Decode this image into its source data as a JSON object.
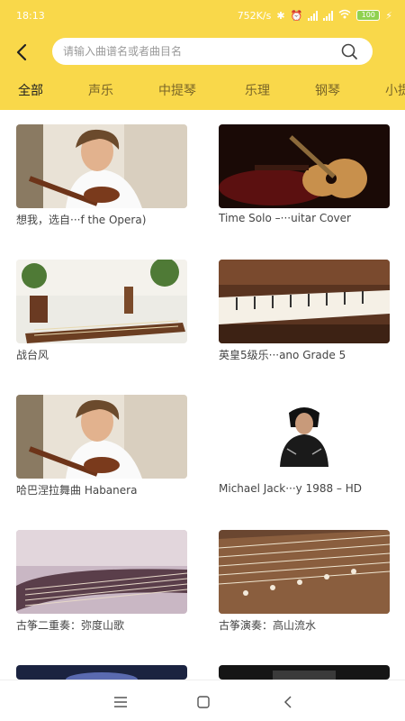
{
  "status_bar": {
    "time": "18:13",
    "net_speed": "752K/s",
    "battery": "100"
  },
  "search": {
    "placeholder": "请输入曲谱名或者曲目名"
  },
  "tabs": [
    {
      "label": "全部",
      "active": true
    },
    {
      "label": "声乐",
      "active": false
    },
    {
      "label": "中提琴",
      "active": false
    },
    {
      "label": "乐理",
      "active": false
    },
    {
      "label": "钢琴",
      "active": false
    },
    {
      "label": "小提",
      "active": false
    }
  ],
  "videos": [
    {
      "title": "想我，选自···f the Opera)",
      "thumb": "violinist"
    },
    {
      "title": "Time Solo –···uitar Cover",
      "thumb": "guitar"
    },
    {
      "title": "战台风",
      "thumb": "guzheng-room"
    },
    {
      "title": "英皇5级乐···ano Grade 5",
      "thumb": "piano"
    },
    {
      "title": "哈巴涅拉舞曲 Habanera",
      "thumb": "violinist"
    },
    {
      "title": "Michael Jack···y 1988 – HD",
      "thumb": "singer"
    },
    {
      "title": "古筝二重奏：弥度山歌",
      "thumb": "guzheng-purple"
    },
    {
      "title": "古筝演奏：高山流水",
      "thumb": "guzheng-wood"
    }
  ],
  "colors": {
    "brand_yellow": "#f9d84a",
    "battery_green": "#8fd14f"
  }
}
